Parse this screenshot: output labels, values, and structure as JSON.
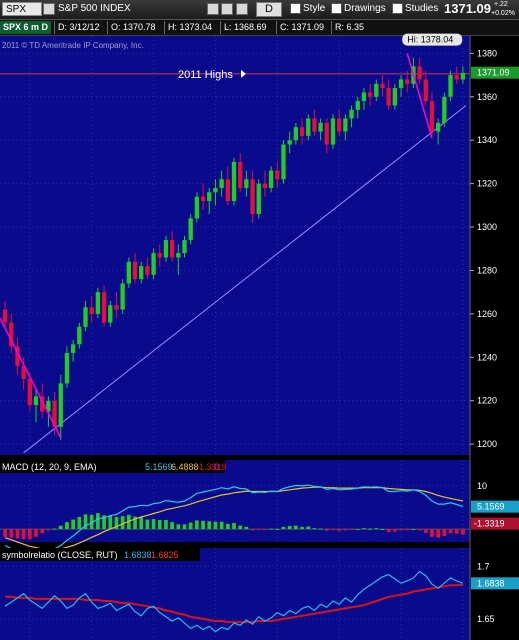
{
  "toolbar": {
    "symbol": "SPX",
    "name": "S&P 500 INDEX",
    "drawing_tool_label": "D",
    "style_label": "Style",
    "drawings_label": "Drawings",
    "studies_label": "Studies",
    "last_price": "1371.09",
    "change_up": "+.22",
    "change_pct": "+0.02%"
  },
  "quote": {
    "symbol_label": "SPX 6 m D",
    "date": "D: 3/12/12",
    "open": "O: 1370.78",
    "high": "H: 1373.04",
    "low": "L: 1368.69",
    "close": "C: 1371.09",
    "range": "R: 6.35"
  },
  "copyright": "2011 © TD Ameritrade IP Company, Inc.",
  "colors": {
    "background": "#000000",
    "panel_bg": "#0a0a8c",
    "grid": "#2a2ab0",
    "up_candle": "#22cc22",
    "down_candle": "#e0103a",
    "trendline": "#9a8cff",
    "highs_line": "#c0304a",
    "pink_line": "#ff00cc",
    "macd_line": "#22ccee",
    "signal_line": "#e8c030",
    "relation_line": "#22bbee",
    "relation_avg": "#dd1111"
  },
  "chart_data": [
    {
      "type": "candlestick",
      "title": "SPX 6 m D",
      "ylim": [
        1195,
        1388
      ],
      "y_ticks": [
        1200,
        1220,
        1240,
        1260,
        1280,
        1300,
        1320,
        1340,
        1360,
        1380
      ],
      "last_value_label": "1371.09",
      "annotations": [
        {
          "text": "Hi: 1378.04",
          "value": 1378.04
        },
        {
          "text": "2011 Highs",
          "value": 1370.58
        }
      ],
      "candles": [
        {
          "o": 1262,
          "h": 1266,
          "l": 1254,
          "c": 1256
        },
        {
          "o": 1256,
          "h": 1260,
          "l": 1242,
          "c": 1245
        },
        {
          "o": 1245,
          "h": 1249,
          "l": 1232,
          "c": 1236
        },
        {
          "o": 1236,
          "h": 1240,
          "l": 1225,
          "c": 1230
        },
        {
          "o": 1230,
          "h": 1233,
          "l": 1215,
          "c": 1218
        },
        {
          "o": 1218,
          "h": 1226,
          "l": 1210,
          "c": 1222
        },
        {
          "o": 1222,
          "h": 1228,
          "l": 1212,
          "c": 1215
        },
        {
          "o": 1215,
          "h": 1222,
          "l": 1208,
          "c": 1220
        },
        {
          "o": 1220,
          "h": 1224,
          "l": 1204,
          "c": 1208
        },
        {
          "o": 1208,
          "h": 1232,
          "l": 1202,
          "c": 1228
        },
        {
          "o": 1228,
          "h": 1245,
          "l": 1226,
          "c": 1242
        },
        {
          "o": 1242,
          "h": 1248,
          "l": 1238,
          "c": 1246
        },
        {
          "o": 1246,
          "h": 1256,
          "l": 1244,
          "c": 1254
        },
        {
          "o": 1254,
          "h": 1266,
          "l": 1252,
          "c": 1263
        },
        {
          "o": 1263,
          "h": 1268,
          "l": 1256,
          "c": 1260
        },
        {
          "o": 1260,
          "h": 1272,
          "l": 1258,
          "c": 1270
        },
        {
          "o": 1270,
          "h": 1273,
          "l": 1254,
          "c": 1256
        },
        {
          "o": 1256,
          "h": 1266,
          "l": 1254,
          "c": 1264
        },
        {
          "o": 1264,
          "h": 1270,
          "l": 1258,
          "c": 1262
        },
        {
          "o": 1262,
          "h": 1276,
          "l": 1260,
          "c": 1274
        },
        {
          "o": 1274,
          "h": 1286,
          "l": 1272,
          "c": 1284
        },
        {
          "o": 1284,
          "h": 1288,
          "l": 1274,
          "c": 1276
        },
        {
          "o": 1276,
          "h": 1284,
          "l": 1274,
          "c": 1282
        },
        {
          "o": 1282,
          "h": 1286,
          "l": 1276,
          "c": 1278
        },
        {
          "o": 1278,
          "h": 1290,
          "l": 1276,
          "c": 1288
        },
        {
          "o": 1288,
          "h": 1292,
          "l": 1282,
          "c": 1286
        },
        {
          "o": 1286,
          "h": 1296,
          "l": 1284,
          "c": 1294
        },
        {
          "o": 1294,
          "h": 1298,
          "l": 1284,
          "c": 1286
        },
        {
          "o": 1286,
          "h": 1292,
          "l": 1278,
          "c": 1288
        },
        {
          "o": 1288,
          "h": 1296,
          "l": 1286,
          "c": 1294
        },
        {
          "o": 1294,
          "h": 1306,
          "l": 1292,
          "c": 1304
        },
        {
          "o": 1304,
          "h": 1316,
          "l": 1302,
          "c": 1314
        },
        {
          "o": 1314,
          "h": 1320,
          "l": 1308,
          "c": 1312
        },
        {
          "o": 1312,
          "h": 1318,
          "l": 1306,
          "c": 1316
        },
        {
          "o": 1316,
          "h": 1322,
          "l": 1310,
          "c": 1318
        },
        {
          "o": 1318,
          "h": 1326,
          "l": 1314,
          "c": 1322
        },
        {
          "o": 1322,
          "h": 1328,
          "l": 1310,
          "c": 1312
        },
        {
          "o": 1312,
          "h": 1332,
          "l": 1310,
          "c": 1330
        },
        {
          "o": 1330,
          "h": 1334,
          "l": 1316,
          "c": 1318
        },
        {
          "o": 1318,
          "h": 1326,
          "l": 1314,
          "c": 1322
        },
        {
          "o": 1322,
          "h": 1326,
          "l": 1302,
          "c": 1306
        },
        {
          "o": 1306,
          "h": 1322,
          "l": 1304,
          "c": 1320
        },
        {
          "o": 1320,
          "h": 1326,
          "l": 1314,
          "c": 1318
        },
        {
          "o": 1318,
          "h": 1328,
          "l": 1316,
          "c": 1326
        },
        {
          "o": 1326,
          "h": 1330,
          "l": 1318,
          "c": 1322
        },
        {
          "o": 1322,
          "h": 1340,
          "l": 1320,
          "c": 1338
        },
        {
          "o": 1338,
          "h": 1344,
          "l": 1334,
          "c": 1340
        },
        {
          "o": 1340,
          "h": 1348,
          "l": 1338,
          "c": 1346
        },
        {
          "o": 1346,
          "h": 1350,
          "l": 1338,
          "c": 1342
        },
        {
          "o": 1342,
          "h": 1352,
          "l": 1340,
          "c": 1350
        },
        {
          "o": 1350,
          "h": 1354,
          "l": 1342,
          "c": 1344
        },
        {
          "o": 1344,
          "h": 1350,
          "l": 1340,
          "c": 1348
        },
        {
          "o": 1348,
          "h": 1350,
          "l": 1334,
          "c": 1338
        },
        {
          "o": 1338,
          "h": 1352,
          "l": 1336,
          "c": 1350
        },
        {
          "o": 1350,
          "h": 1354,
          "l": 1342,
          "c": 1344
        },
        {
          "o": 1344,
          "h": 1352,
          "l": 1340,
          "c": 1350
        },
        {
          "o": 1350,
          "h": 1356,
          "l": 1346,
          "c": 1354
        },
        {
          "o": 1354,
          "h": 1360,
          "l": 1350,
          "c": 1358
        },
        {
          "o": 1358,
          "h": 1364,
          "l": 1354,
          "c": 1362
        },
        {
          "o": 1362,
          "h": 1366,
          "l": 1356,
          "c": 1360
        },
        {
          "o": 1360,
          "h": 1368,
          "l": 1358,
          "c": 1366
        },
        {
          "o": 1366,
          "h": 1370,
          "l": 1360,
          "c": 1364
        },
        {
          "o": 1364,
          "h": 1368,
          "l": 1354,
          "c": 1356
        },
        {
          "o": 1356,
          "h": 1366,
          "l": 1354,
          "c": 1364
        },
        {
          "o": 1364,
          "h": 1370,
          "l": 1360,
          "c": 1368
        },
        {
          "o": 1368,
          "h": 1372,
          "l": 1362,
          "c": 1366
        },
        {
          "o": 1366,
          "h": 1378,
          "l": 1364,
          "c": 1374
        },
        {
          "o": 1374,
          "h": 1378,
          "l": 1366,
          "c": 1368
        },
        {
          "o": 1368,
          "h": 1372,
          "l": 1356,
          "c": 1358
        },
        {
          "o": 1358,
          "h": 1362,
          "l": 1342,
          "c": 1344
        },
        {
          "o": 1344,
          "h": 1350,
          "l": 1338,
          "c": 1348
        },
        {
          "o": 1348,
          "h": 1362,
          "l": 1346,
          "c": 1360
        },
        {
          "o": 1360,
          "h": 1372,
          "l": 1358,
          "c": 1370
        },
        {
          "o": 1370,
          "h": 1374,
          "l": 1366,
          "c": 1368
        },
        {
          "o": 1368,
          "h": 1374,
          "l": 1366,
          "c": 1371
        }
      ]
    },
    {
      "type": "line",
      "title": "MACD (12, 20, 9, EMA)",
      "ylim": [
        -3,
        13
      ],
      "y_ticks": [
        10
      ],
      "legend_values": [
        "5.1569",
        "6.4888",
        "-1.3319",
        "0"
      ],
      "last_value_labels": [
        "5.1569",
        "-1.3319"
      ],
      "series": [
        {
          "name": "MACD",
          "values": [
            -3.8,
            -4.5,
            -5.2,
            -5.8,
            -6.4,
            -6.1,
            -5.6,
            -5,
            -4.6,
            -3.8,
            -2.6,
            -1.6,
            -0.4,
            0.8,
            1.4,
            2.4,
            2.6,
            3.1,
            3.4,
            4.2,
            5.1,
            5.2,
            5.5,
            5.4,
            5.9,
            6.1,
            6.6,
            6.4,
            6.2,
            6.5,
            7.3,
            8.3,
            8.6,
            8.9,
            9.2,
            9.6,
            9.3,
            9.8,
            9.4,
            9.3,
            8.4,
            8.6,
            8.5,
            8.8,
            8.7,
            9.4,
            9.8,
            10.1,
            10,
            10.2,
            9.9,
            9.8,
            9.2,
            9.4,
            9.1,
            9.2,
            9.3,
            9.5,
            9.8,
            9.7,
            9.8,
            9.6,
            8.7,
            8.7,
            8.9,
            8.8,
            9.1,
            8.7,
            7.8,
            6.5,
            5.8,
            5.8,
            6.1,
            5.7,
            5.2
          ]
        },
        {
          "name": "Signal",
          "values": [
            -2,
            -2.5,
            -3,
            -3.5,
            -4,
            -4.3,
            -4.6,
            -4.7,
            -4.7,
            -4.6,
            -4.2,
            -3.8,
            -3.2,
            -2.6,
            -1.9,
            -1.3,
            -0.6,
            0,
            0.6,
            1.2,
            1.8,
            2.3,
            2.8,
            3.2,
            3.6,
            4,
            4.5,
            4.8,
            5.1,
            5.4,
            5.8,
            6.3,
            6.7,
            7.1,
            7.5,
            7.9,
            8.1,
            8.4,
            8.6,
            8.8,
            8.7,
            8.7,
            8.7,
            8.7,
            8.7,
            8.9,
            9.1,
            9.3,
            9.5,
            9.6,
            9.7,
            9.7,
            9.6,
            9.6,
            9.5,
            9.5,
            9.5,
            9.5,
            9.6,
            9.6,
            9.6,
            9.6,
            9.4,
            9.3,
            9.2,
            9.1,
            9.1,
            9,
            8.7,
            8.3,
            7.8,
            7.4,
            7.1,
            6.8,
            6.5
          ]
        },
        {
          "name": "Diff",
          "values": [
            -1.8,
            -2,
            -2.2,
            -2.3,
            -2.4,
            -1.8,
            -1,
            -0.3,
            0.1,
            0.8,
            1.6,
            2.2,
            2.8,
            3.4,
            3.3,
            3.7,
            3.2,
            3.1,
            2.8,
            3,
            3.3,
            2.9,
            2.7,
            2.2,
            2.3,
            2.1,
            2.1,
            1.6,
            1.1,
            1.1,
            1.5,
            2,
            1.9,
            1.8,
            1.7,
            1.7,
            1.2,
            1.4,
            0.8,
            0.5,
            -0.3,
            -0.1,
            -0.2,
            0.1,
            0,
            0.5,
            0.7,
            0.8,
            0.5,
            0.6,
            0.2,
            0.1,
            -0.4,
            -0.2,
            -0.4,
            -0.3,
            -0.2,
            0,
            0.2,
            0.1,
            0.2,
            0,
            -0.7,
            -0.6,
            -0.3,
            -0.3,
            0,
            -0.3,
            -0.9,
            -1.8,
            -2,
            -1.6,
            -1,
            -1.1,
            -1.3
          ]
        }
      ]
    },
    {
      "type": "line",
      "title": "symbolrelatio (CLOSE, RUT)",
      "ylim": [
        1.63,
        1.705
      ],
      "y_ticks": [
        1.65,
        1.7
      ],
      "y_tick_labels": [
        "1.65",
        "1.7"
      ],
      "legend_values": [
        "1.6838",
        "1.6825"
      ],
      "last_value_labels": [
        "1.6838"
      ],
      "series": [
        {
          "name": "Relation",
          "values": [
            1.662,
            1.666,
            1.67,
            1.674,
            1.668,
            1.664,
            1.66,
            1.666,
            1.672,
            1.667,
            1.66,
            1.663,
            1.67,
            1.674,
            1.666,
            1.66,
            1.662,
            1.665,
            1.658,
            1.661,
            1.664,
            1.657,
            1.653,
            1.66,
            1.662,
            1.656,
            1.652,
            1.648,
            1.651,
            1.646,
            1.641,
            1.644,
            1.64,
            1.643,
            1.638,
            1.642,
            1.64,
            1.646,
            1.644,
            1.649,
            1.645,
            1.652,
            1.648,
            1.651,
            1.656,
            1.653,
            1.658,
            1.655,
            1.66,
            1.662,
            1.658,
            1.664,
            1.661,
            1.667,
            1.664,
            1.67,
            1.666,
            1.673,
            1.678,
            1.682,
            1.686,
            1.69,
            1.692,
            1.688,
            1.684,
            1.686,
            1.689,
            1.695,
            1.691,
            1.683,
            1.679,
            1.684,
            1.689,
            1.686,
            1.6838
          ]
        },
        {
          "name": "Average",
          "values": [
            1.671,
            1.671,
            1.67,
            1.67,
            1.67,
            1.669,
            1.669,
            1.669,
            1.669,
            1.669,
            1.669,
            1.669,
            1.669,
            1.668,
            1.668,
            1.668,
            1.667,
            1.667,
            1.666,
            1.665,
            1.665,
            1.664,
            1.663,
            1.662,
            1.661,
            1.66,
            1.658,
            1.657,
            1.655,
            1.654,
            1.652,
            1.651,
            1.65,
            1.649,
            1.648,
            1.648,
            1.647,
            1.647,
            1.647,
            1.647,
            1.647,
            1.648,
            1.648,
            1.648,
            1.649,
            1.65,
            1.651,
            1.652,
            1.653,
            1.654,
            1.655,
            1.656,
            1.657,
            1.658,
            1.659,
            1.66,
            1.661,
            1.662,
            1.663,
            1.665,
            1.667,
            1.669,
            1.671,
            1.672,
            1.673,
            1.674,
            1.676,
            1.677,
            1.678,
            1.679,
            1.68,
            1.681,
            1.682,
            1.682,
            1.6825
          ]
        }
      ]
    }
  ]
}
